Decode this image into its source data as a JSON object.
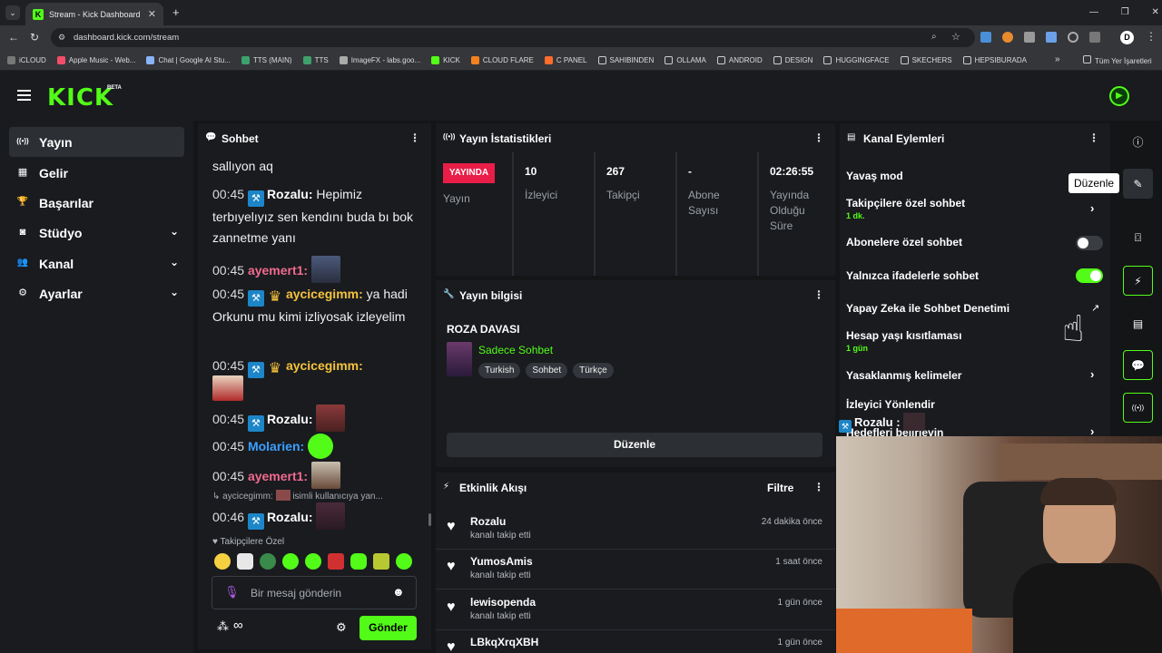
{
  "browser": {
    "tab_title": "Stream - Kick Dashboard",
    "tab_close": "✕",
    "new_tab": "+",
    "url": "dashboard.kick.com/stream",
    "bookmarks": [
      "iCLOUD",
      "Apple Music - Web...",
      "Chat | Google AI Stu...",
      "TTS (MAIN)",
      "TTS",
      "ImageFX - labs.goo...",
      "KICK",
      "CLOUD FLARE",
      "C PANEL",
      "SAHIBINDEN",
      "OLLAMA",
      "ANDROID",
      "DESIGN",
      "HUGGINGFACE",
      "SKECHERS",
      "HEPSIBURADA"
    ],
    "bookmarks_more": "»",
    "all_bookmarks": "Tüm Yer İşaretleri"
  },
  "brand": {
    "logo": "KICK",
    "beta": "BETA"
  },
  "sidebar": {
    "items": [
      {
        "label": "Yayın",
        "icon": "broadcast-icon",
        "glyph": "((•))"
      },
      {
        "label": "Gelir",
        "icon": "revenue-icon",
        "glyph": "▦"
      },
      {
        "label": "Başarılar",
        "icon": "trophy-icon",
        "glyph": "🏆"
      },
      {
        "label": "Stüdyo",
        "icon": "studio-icon",
        "glyph": "◙"
      },
      {
        "label": "Kanal",
        "icon": "users-icon",
        "glyph": "👥"
      },
      {
        "label": "Ayarlar",
        "icon": "gear-icon",
        "glyph": "⚙"
      }
    ]
  },
  "chat": {
    "title": "Sohbet",
    "messages": [
      {
        "partial": "sallıyon aq"
      },
      {
        "time": "00:45",
        "user": "Rozalu:",
        "text": "Hepimiz terbıyelıyız sen kendını buda bı bok zannetme yanı"
      },
      {
        "time": "00:45",
        "user": "ayemert1:"
      },
      {
        "time": "00:45",
        "user": "aycicegimm:",
        "text": "ya hadi Orkunu mu kimi izliyosak izleyelim"
      },
      {
        "time": "00:45",
        "user": "aycicegimm:"
      },
      {
        "time": "00:45",
        "user": "Rozalu:"
      },
      {
        "time": "00:45",
        "user": "Molarien:"
      },
      {
        "time": "00:45",
        "user": "ayemert1:"
      },
      {
        "reply_user": "aycicegimm:",
        "reply_text": "isimli kullanıcıya yan..."
      },
      {
        "time": "00:46",
        "user": "Rozalu:"
      }
    ],
    "followers_only": "Takipçilere Özel",
    "input_placeholder": "Bir mesaj gönderin",
    "send": "Gönder"
  },
  "stats": {
    "title": "Yayın İstatistikleri",
    "live_badge": "YAYINDA",
    "live_label": "Yayın",
    "viewers_value": "10",
    "viewers_label": "İzleyici",
    "followers_value": "267",
    "followers_label": "Takipçi",
    "subs_value": "-",
    "subs_label": "Abone Sayısı",
    "duration_value": "02:26:55",
    "duration_label": "Yayında Olduğu Süre"
  },
  "stream_info": {
    "title": "Yayın bilgisi",
    "stream_title": "ROZA DAVASI",
    "category": "Sadece Sohbet",
    "tags": [
      "Turkish",
      "Sohbet",
      "Türkçe"
    ],
    "edit_button": "Düzenle"
  },
  "activity": {
    "title": "Etkinlik Akışı",
    "filter": "Filtre",
    "items": [
      {
        "name": "Rozalu",
        "action": "kanalı takip etti",
        "time": "24 dakika önce"
      },
      {
        "name": "YumosAmis",
        "action": "kanalı takip etti",
        "time": "1 saat önce"
      },
      {
        "name": "lewisopenda",
        "action": "kanalı takip etti",
        "time": "1 gün önce"
      },
      {
        "name": "LBkqXrqXBH",
        "action": "",
        "time": "1 gün önce"
      }
    ]
  },
  "channel_actions": {
    "title": "Kanal Eylemleri",
    "slow_mode": "Yavaş mod",
    "followers_chat": "Takipçilere özel sohbet",
    "followers_chat_sub": "1 dk.",
    "subs_chat": "Abonelere özel sohbet",
    "subs_chat_on": false,
    "emote_chat": "Yalnızca ifadelerle sohbet",
    "emote_chat_on": true,
    "ai_moderation": "Yapay Zeka ile Sohbet Denetimi",
    "age_restriction": "Hesap yaşı kısıtlaması",
    "age_restriction_sub": "1 gün",
    "banned_words": "Yasaklanmış kelimeler",
    "redirect": "İzleyici Yönlendir",
    "goals": "Hedefleri belirleyin",
    "overlay_user": "Rozalu :",
    "tooltip": "Düzenle"
  },
  "colors": {
    "brand": "#53fc18",
    "live": "#e91e48"
  }
}
